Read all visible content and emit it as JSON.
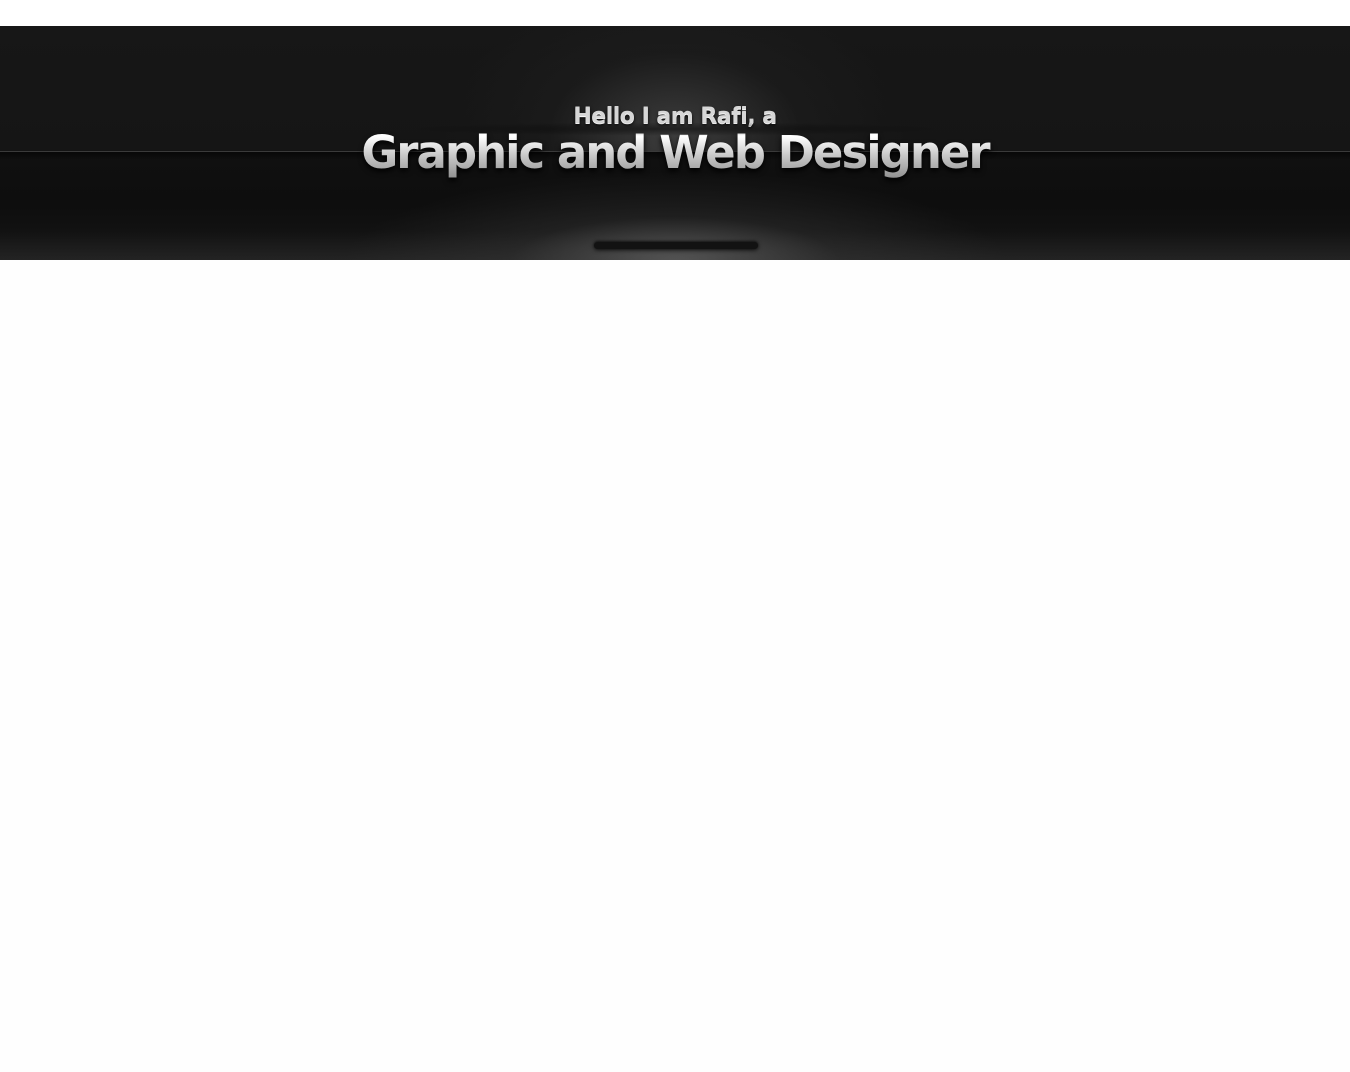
{
  "hero": {
    "greeting": "Hello I am Rafi, a",
    "headline": "Graphic and Web Designer"
  },
  "colors": {
    "banner_background": "#151515",
    "page_background": "#fefefe",
    "headline_text": "#e2e2e2"
  }
}
